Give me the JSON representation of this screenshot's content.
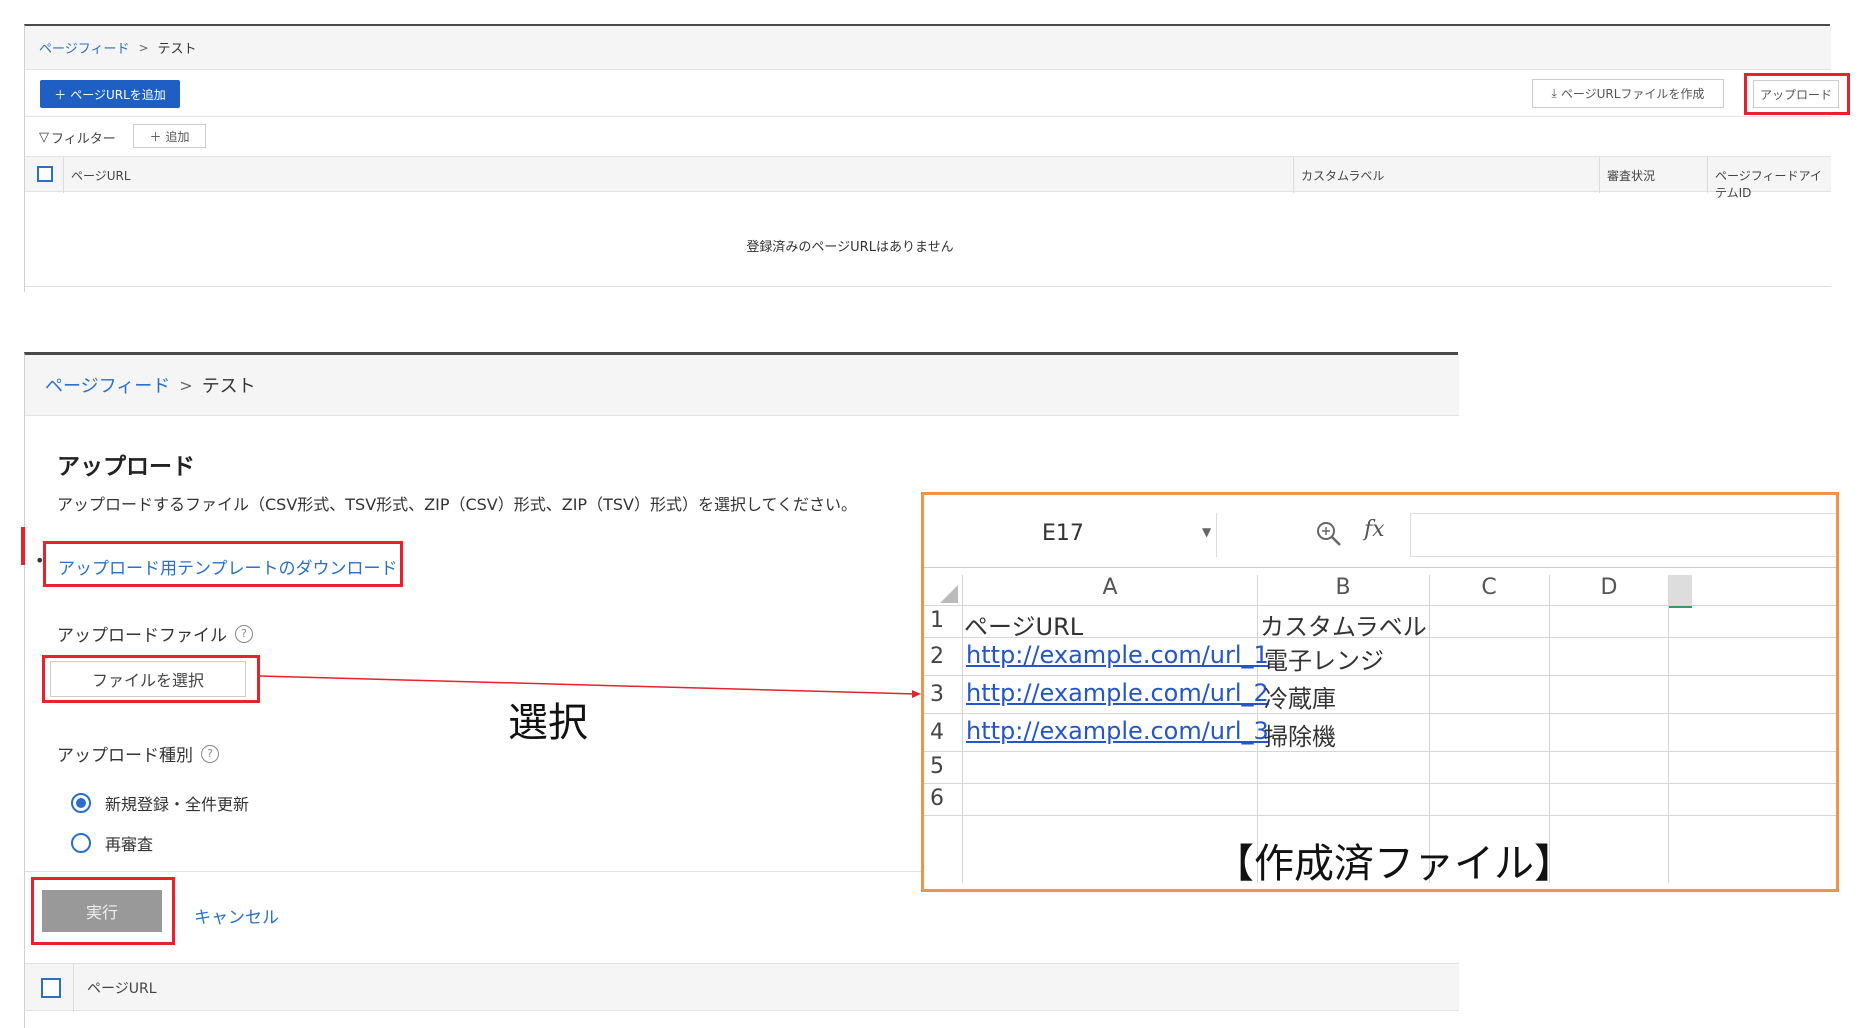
{
  "top": {
    "breadcrumb": {
      "parent": "ページフィード",
      "current": "テスト"
    },
    "add_url_button": "ページURLを追加",
    "create_file_button": "ページURLファイルを作成",
    "upload_button": "アップロード",
    "filter_label": "フィルター",
    "add_filter_button": "追加",
    "columns": [
      "ページURL",
      "カスタムラベル",
      "審査状況",
      "ページフィードアイテムID"
    ],
    "empty_message": "登録済みのページURLはありません"
  },
  "upload": {
    "breadcrumb": {
      "parent": "ページフィード",
      "current": "テスト"
    },
    "title": "アップロード",
    "description": "アップロードするファイル（CSV形式、TSV形式、ZIP（CSV）形式、ZIP（TSV）形式）を選択してください。",
    "template_link": "アップロード用テンプレートのダウンロード",
    "file_label": "アップロードファイル",
    "choose_file_button": "ファイルを選択",
    "type_label": "アップロード種別",
    "options": [
      {
        "label": "新規登録・全件更新",
        "selected": true
      },
      {
        "label": "再審査",
        "selected": false
      }
    ],
    "run_button": "実行",
    "cancel_link": "キャンセル",
    "table_column": "ページURL"
  },
  "annotation": {
    "select_label": "選択",
    "created_file_label": "【作成済ファイル】"
  },
  "excel": {
    "name_box": "E17",
    "fx": "fx",
    "columns": [
      "A",
      "B",
      "C",
      "D"
    ],
    "rows": [
      {
        "num": "1",
        "a": "ページURL",
        "b": "カスタムラベル"
      },
      {
        "num": "2",
        "a": "http://example.com/url_1",
        "b": "電子レンジ"
      },
      {
        "num": "3",
        "a": "http://example.com/url_2",
        "b": "冷蔵庫"
      },
      {
        "num": "4",
        "a": "http://example.com/url_3",
        "b": "掃除機"
      },
      {
        "num": "5",
        "a": "",
        "b": ""
      },
      {
        "num": "6",
        "a": "",
        "b": ""
      }
    ]
  }
}
